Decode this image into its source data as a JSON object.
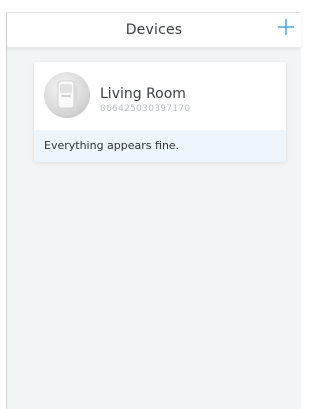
{
  "header": {
    "title": "Devices",
    "add_icon": "plus-icon"
  },
  "devices": [
    {
      "name": "Living Room",
      "id": "866425030397170",
      "status": "Everything appears fine.",
      "icon": "motion-sensor-icon"
    }
  ],
  "colors": {
    "accent": "#3aa3e3",
    "status_bg": "#eef5fb",
    "app_bg": "#f3f4f6"
  }
}
